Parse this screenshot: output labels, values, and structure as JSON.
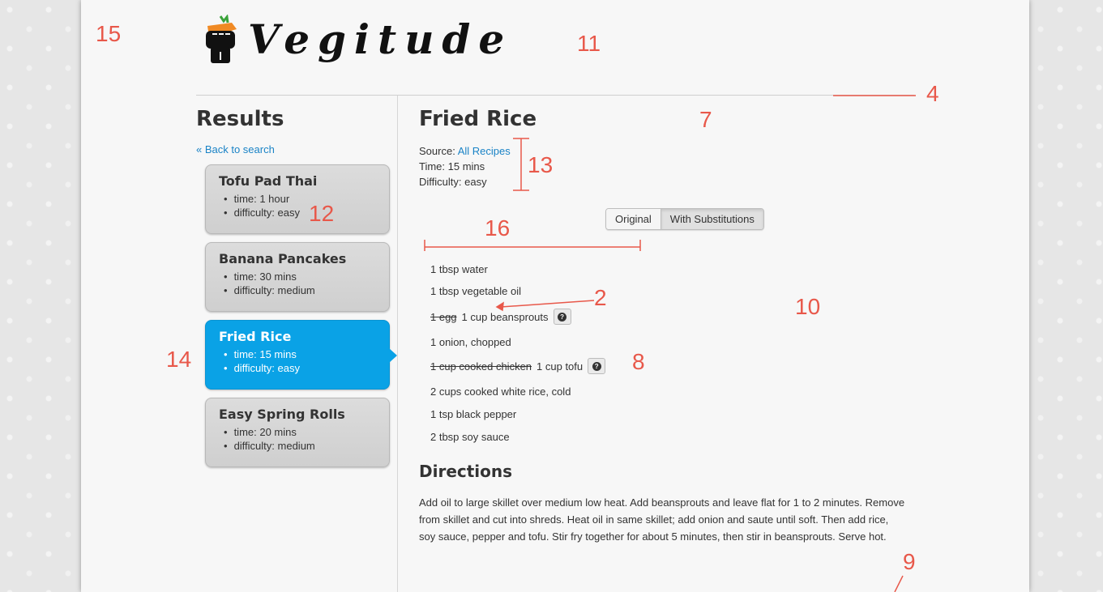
{
  "brand": {
    "name": "Vegitude"
  },
  "sidebar": {
    "heading": "Results",
    "back_link": "« Back to search",
    "recipes": [
      {
        "name": "Tofu Pad Thai",
        "time": "time: 1 hour",
        "difficulty": "difficulty: easy",
        "active": false
      },
      {
        "name": "Banana Pancakes",
        "time": "time: 30 mins",
        "difficulty": "difficulty: medium",
        "active": false
      },
      {
        "name": "Fried Rice",
        "time": "time: 15 mins",
        "difficulty": "difficulty: easy",
        "active": true
      },
      {
        "name": "Easy Spring Rolls",
        "time": "time: 20 mins",
        "difficulty": "difficulty: medium",
        "active": false
      }
    ]
  },
  "recipe": {
    "title": "Fried Rice",
    "source_label": "Source:",
    "source_link": "All Recipes",
    "time": "Time: 15 mins",
    "difficulty": "Difficulty: easy",
    "toggle": {
      "original": "Original",
      "substitutions": "With Substitutions",
      "selected": "With Substitutions"
    },
    "ingredients": [
      {
        "text": "1 tbsp water"
      },
      {
        "text": "1 tbsp vegetable oil"
      },
      {
        "original": "1 egg",
        "text": "1 cup beansprouts",
        "help": true
      },
      {
        "text": "1 onion, chopped"
      },
      {
        "original": "1 cup cooked chicken",
        "text": "1 cup tofu",
        "help": true
      },
      {
        "text": "2 cups cooked white rice, cold"
      },
      {
        "text": "1 tsp black pepper"
      },
      {
        "text": "2 tbsp soy sauce"
      }
    ],
    "directions_heading": "Directions",
    "directions": "Add oil to large skillet over medium low heat. Add beansprouts and leave flat for 1 to 2 minutes. Remove from skillet and cut into shreds. Heat oil in same skillet; add onion and saute until soft. Then add rice, soy sauce, pepper and tofu. Stir fry together for about 5 minutes, then stir in beansprouts. Serve hot."
  },
  "annotations": {
    "n15": "15",
    "n11": "11",
    "n4": "4",
    "n7": "7",
    "n13": "13",
    "n12": "12",
    "n16": "16",
    "n2": "2",
    "n10": "10",
    "n14": "14",
    "n8": "8",
    "n9": "9"
  },
  "colors": {
    "accent": "#0aa2e6",
    "link": "#1a83c6",
    "annotation": "#e8584a"
  }
}
